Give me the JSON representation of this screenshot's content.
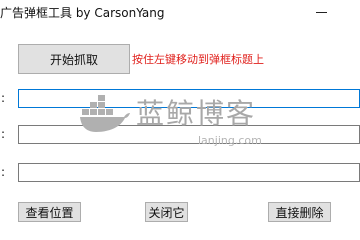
{
  "window": {
    "title": "广告弹框工具 by CarsonYang"
  },
  "toolbar": {
    "start_label": "开始抓取",
    "hint_text": "按住左键移动到弹框标题上"
  },
  "fields": [
    {
      "label": ":",
      "value": ""
    },
    {
      "label": ":",
      "value": ""
    },
    {
      "label": ":",
      "value": ""
    }
  ],
  "actions": {
    "view_label": "查看位置",
    "close_label": "关闭它",
    "delete_label": "直接删除"
  },
  "watermark": {
    "text": "蓝鲸博客",
    "url": "lanjing.com",
    "icon": "whale-docker-icon"
  },
  "colors": {
    "hint": "#e0201c",
    "focus_border": "#0078d7",
    "button_bg": "#e1e1e1"
  }
}
